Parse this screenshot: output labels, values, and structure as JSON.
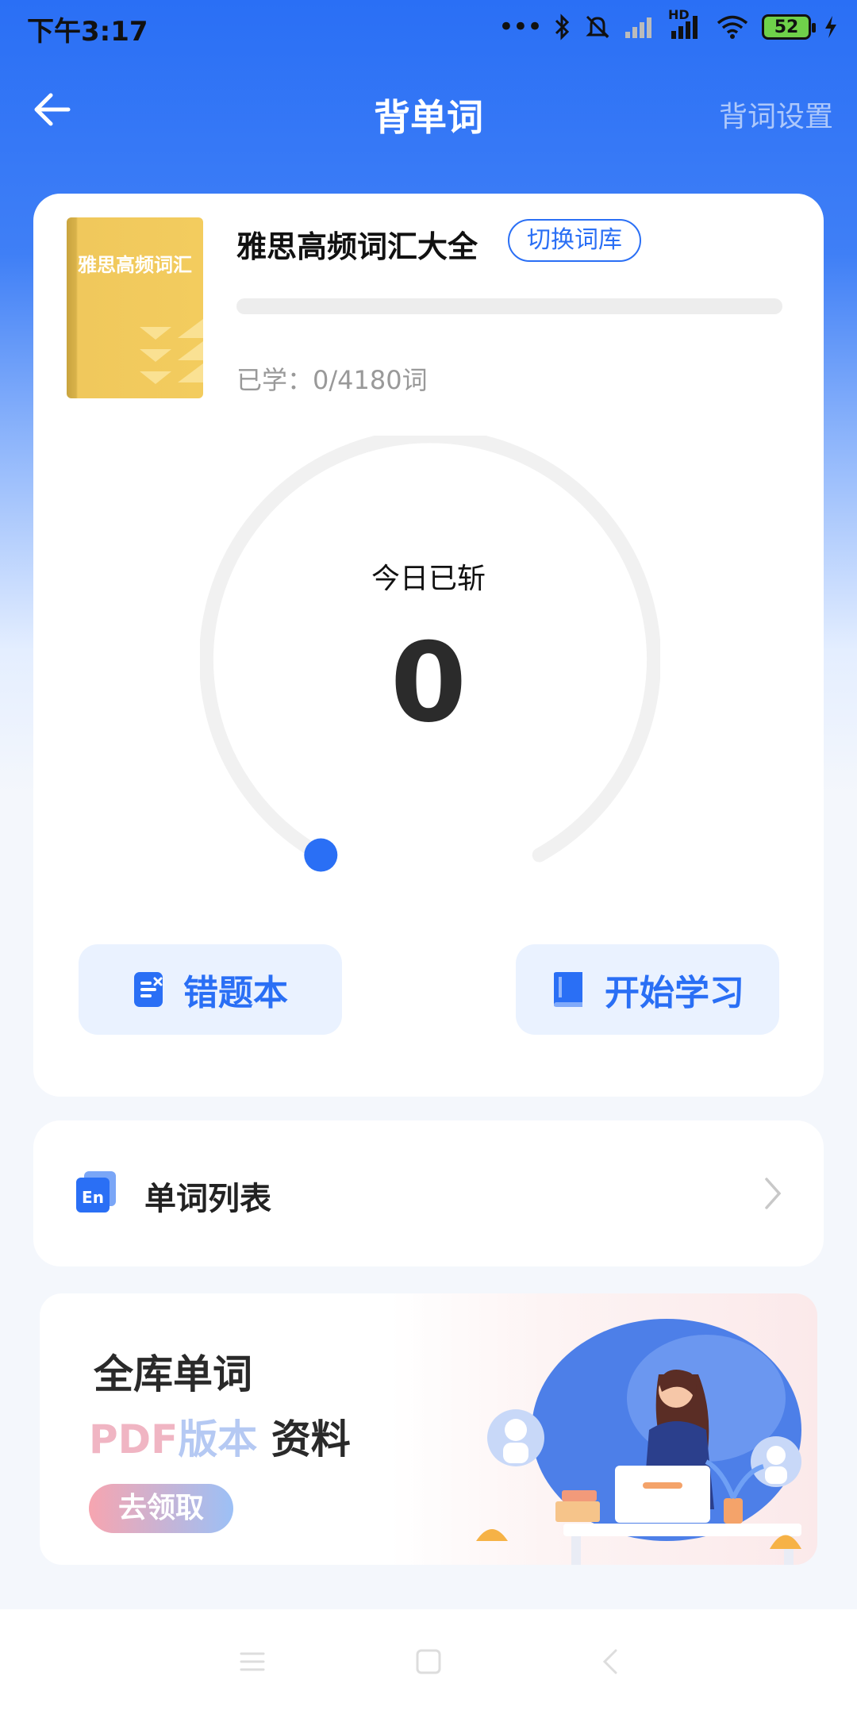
{
  "status_bar": {
    "time": "下午3:17",
    "signal_dots": "•••",
    "hd": "HD",
    "battery": "52"
  },
  "header": {
    "title": "背单词",
    "settings_label": "背词设置"
  },
  "book": {
    "cover_title": "雅思高频词汇",
    "name": "雅思高频词汇大全",
    "switch_label": "切换词库",
    "learned_text": "已学：0/4180词",
    "progress": 0
  },
  "today": {
    "label": "今日已斩",
    "count": "0"
  },
  "buttons": {
    "mistakes_label": "错题本",
    "start_label": "开始学习"
  },
  "word_list": {
    "icon_text": "En",
    "label": "单词列表"
  },
  "banner": {
    "line1": "全库单词",
    "line2_pdf": "PDF",
    "line2_version": "版本",
    "line2_material": "资料",
    "button_label": "去领取"
  },
  "colors": {
    "accent": "#2a6ff5",
    "book_cover": "#f3cc5e"
  }
}
